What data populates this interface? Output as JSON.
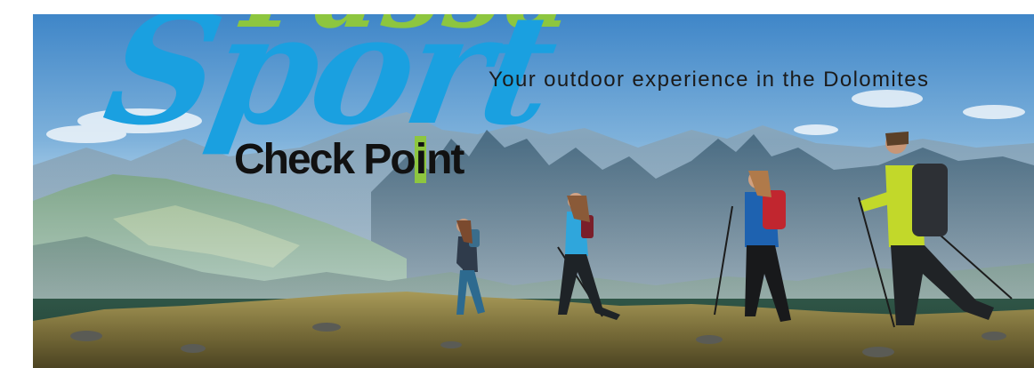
{
  "logo": {
    "top_word": "Fassa",
    "main_word": "Sport",
    "sub_before": "Check Po",
    "sub_highlight": "i",
    "sub_after": "nt"
  },
  "tagline": "Your outdoor experience in the Dolomites",
  "colors": {
    "brand_blue": "#1aa0e0",
    "brand_green": "#8dc63f",
    "text_dark": "#111111"
  }
}
